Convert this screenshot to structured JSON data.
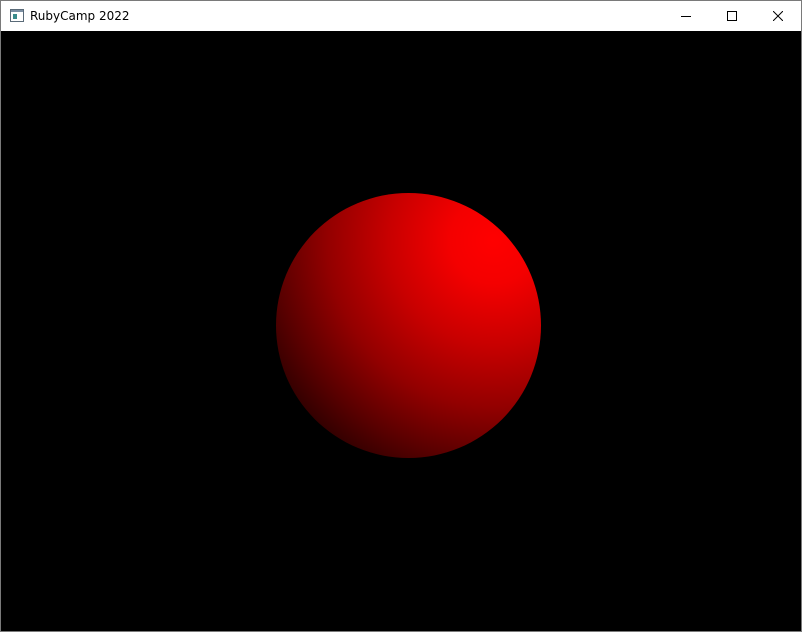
{
  "window": {
    "title": "RubyCamp 2022",
    "controls": {
      "minimize_icon": "minimize-icon",
      "maximize_icon": "maximize-icon",
      "close_icon": "close-icon"
    }
  },
  "scene": {
    "background_color": "#000000",
    "sphere_color": "#ff0000",
    "sphere_shadow_color": "#000000"
  }
}
